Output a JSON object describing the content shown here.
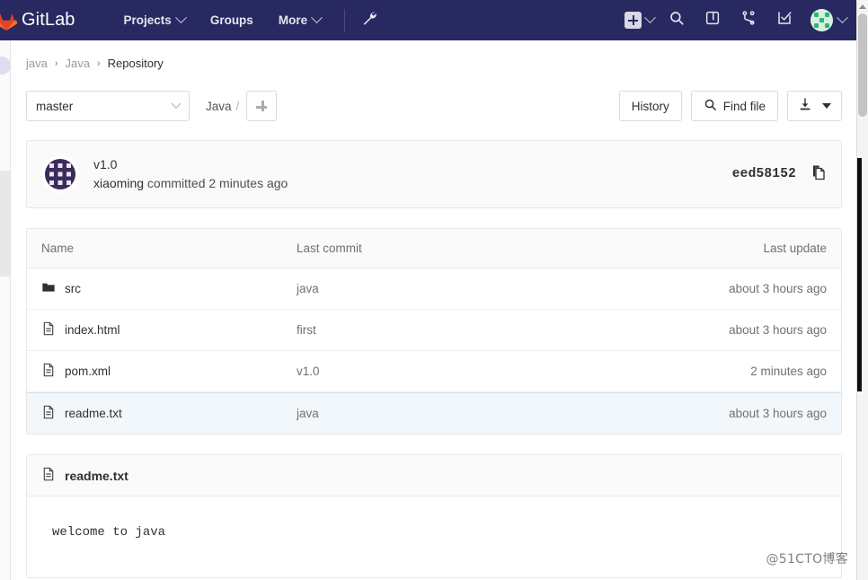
{
  "navbar": {
    "brand": "GitLab",
    "logo_icon": "gitlab-tanuki-icon",
    "links": [
      {
        "label": "Projects",
        "has_caret": true
      },
      {
        "label": "Groups",
        "has_caret": false
      },
      {
        "label": "More",
        "has_caret": true
      }
    ],
    "wrench_icon": "wrench-icon",
    "actions": [
      {
        "name": "new-dropdown",
        "icon": "plus-square-icon",
        "has_caret": true
      },
      {
        "name": "search",
        "icon": "search-icon"
      },
      {
        "name": "issue-boards",
        "icon": "issue-board-icon"
      },
      {
        "name": "merge-requests",
        "icon": "merge-request-icon"
      },
      {
        "name": "todos",
        "icon": "todo-check-icon"
      },
      {
        "name": "user-menu",
        "icon": "avatar-icon",
        "has_caret": true
      }
    ]
  },
  "breadcrumb": {
    "group": "java",
    "project": "Java",
    "current": "Repository",
    "separator": "›"
  },
  "toolbar": {
    "branch": "master",
    "path_root": "Java",
    "path_separator": "/",
    "add_button_icon": "plus-icon",
    "history_label": "History",
    "find_file_label": "Find file",
    "find_file_icon": "search-icon",
    "download_icon": "download-icon",
    "download_caret_icon": "caret-down-icon"
  },
  "commit": {
    "avatar_icon": "identicon-avatar",
    "title": "v1.0",
    "author": "xiaoming",
    "meta_suffix": "committed 2 minutes ago",
    "sha": "eed58152",
    "copy_icon": "copy-icon"
  },
  "file_table": {
    "headers": {
      "name": "Name",
      "last_commit": "Last commit",
      "last_update": "Last update"
    },
    "rows": [
      {
        "icon": "folder-icon",
        "name": "src",
        "last_commit": "java",
        "last_update": "about 3 hours ago",
        "highlight": false
      },
      {
        "icon": "file-icon",
        "name": "index.html",
        "last_commit": "first",
        "last_update": "about 3 hours ago",
        "highlight": false
      },
      {
        "icon": "file-icon",
        "name": "pom.xml",
        "last_commit": "v1.0",
        "last_update": "2 minutes ago",
        "highlight": false
      },
      {
        "icon": "file-icon",
        "name": "readme.txt",
        "last_commit": "java",
        "last_update": "about 3 hours ago",
        "highlight": true
      }
    ]
  },
  "readme": {
    "icon": "file-icon",
    "title": "readme.txt",
    "content": "welcome to java"
  },
  "watermark": "@51CTO博客",
  "colors": {
    "navbar_bg": "#292961",
    "accent_orange": "#e24329",
    "highlight_row": "#f2f7fc",
    "panel_bg": "#fafafa",
    "border": "#e8e8e8",
    "text_primary": "#303030",
    "text_muted": "#707070"
  }
}
